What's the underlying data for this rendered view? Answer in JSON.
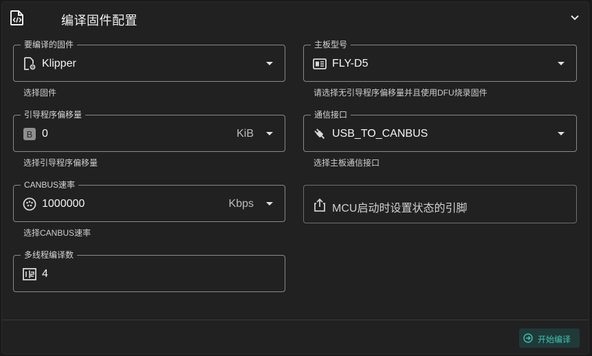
{
  "header": {
    "title": "编译固件配置",
    "icon": "file-code-icon",
    "collapse_icon": "chevron-down-icon"
  },
  "fields": {
    "firmware": {
      "legend": "要编译的固件",
      "value": "Klipper",
      "hint": "选择固件",
      "icon": "file-gear-icon"
    },
    "board": {
      "legend": "主板型号",
      "value": "FLY-D5",
      "hint": "请选择无引导程序偏移量并且使用DFU烧录固件",
      "icon": "board-chip-icon"
    },
    "bootloader_offset": {
      "legend": "引导程序偏移量",
      "value": "0",
      "unit": "KiB",
      "hint": "选择引导程序偏移量",
      "icon": "b-box-icon",
      "icon_text": "B"
    },
    "interface": {
      "legend": "通信接口",
      "value": "USB_TO_CANBUS",
      "hint": "选择主板通信接口",
      "icon": "usb-plug-icon"
    },
    "canbus_speed": {
      "legend": "CANBUS速率",
      "value": "1000000",
      "unit": "Kbps",
      "hint": "选择CANBUS速率",
      "icon": "serial-port-icon"
    },
    "threads": {
      "legend": "多线程编译数",
      "value": "4",
      "icon": "numeric-box-icon",
      "icon_text": "1|2"
    }
  },
  "mcu_button": {
    "label": "MCU启动时设置状态的引脚",
    "icon": "share-upload-icon"
  },
  "compile_button": {
    "label": "开始编译",
    "icon": "arrow-circle-right-icon",
    "color": "#3fc3b0"
  }
}
